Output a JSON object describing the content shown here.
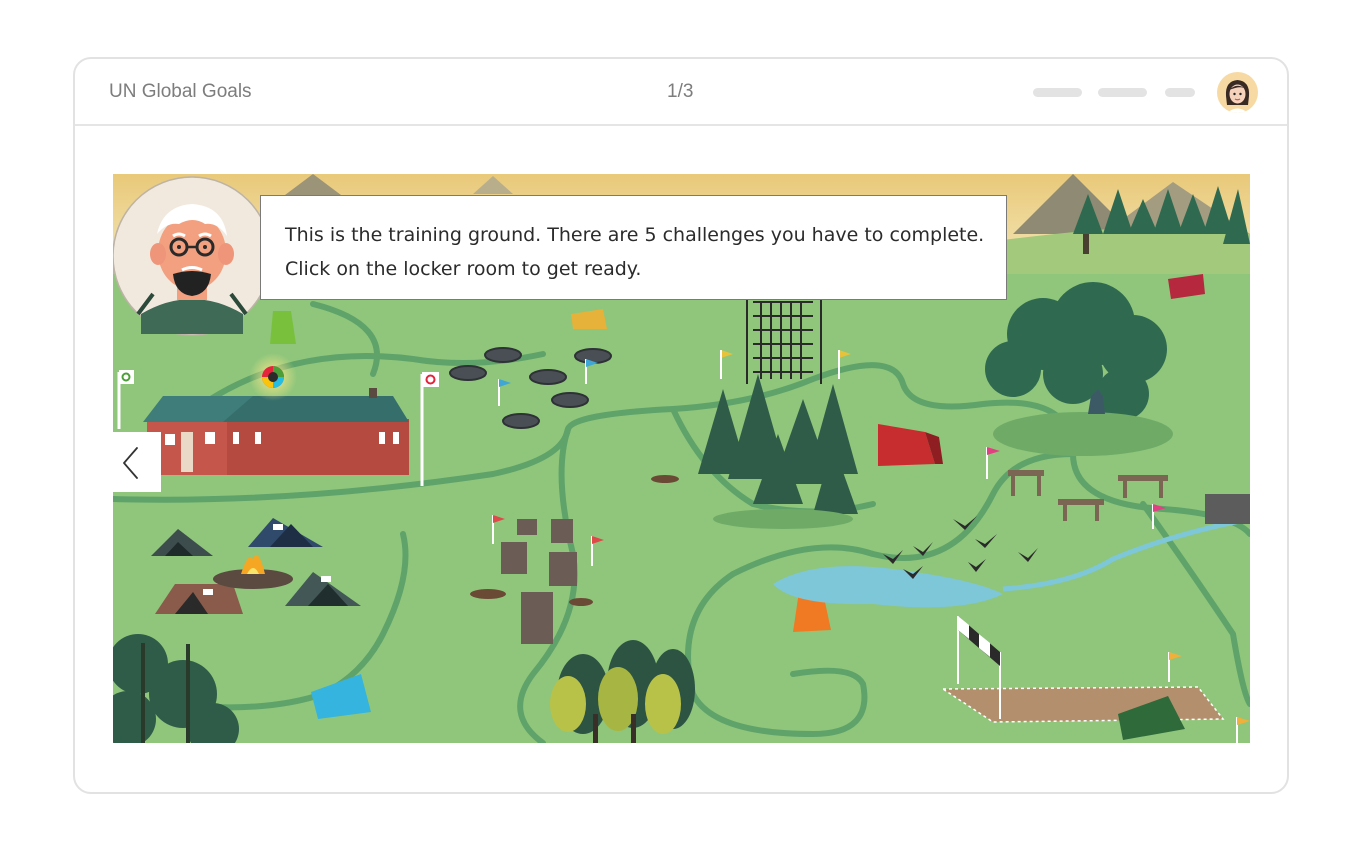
{
  "header": {
    "title": "UN Global Goals",
    "page_counter": "1/3",
    "avatar_icon": "user-avatar-icon"
  },
  "scene": {
    "narrator_text": "This is the training ground. There are 5 challenges you have to complete. Click on the locker room to get ready.",
    "narrator_icon": "old-man-coach-avatar",
    "back_icon": "chevron-left-icon",
    "colors": {
      "grass": "#8fc67b",
      "path": "#5fa36a",
      "building": "#b54a40",
      "roof": "#3f7d7a"
    }
  }
}
